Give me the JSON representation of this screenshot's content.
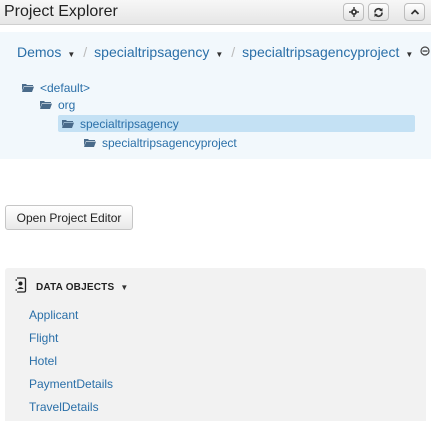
{
  "header": {
    "title": "Project Explorer",
    "buttons": [
      {
        "name": "settings",
        "icon": "gear-icon"
      },
      {
        "name": "refresh",
        "icon": "refresh-icon"
      },
      {
        "name": "collapse",
        "icon": "chevron-up-icon"
      }
    ]
  },
  "breadcrumb": {
    "items": [
      {
        "label": "Demos",
        "has_caret": true
      },
      {
        "label": "specialtripsagency",
        "has_caret": true
      },
      {
        "label": "specialtripsagencyproject",
        "has_caret": true
      }
    ],
    "collapse_icon": "minus-circle-icon"
  },
  "tree": {
    "nodes": [
      {
        "label": "<default>",
        "level": 0,
        "selected": false
      },
      {
        "label": "org",
        "level": 1,
        "selected": false
      },
      {
        "label": "specialtripsagency",
        "level": 2,
        "selected": true
      },
      {
        "label": "specialtripsagencyproject",
        "level": 3,
        "selected": false
      }
    ]
  },
  "open_project_editor": {
    "label": "Open Project Editor"
  },
  "data_objects": {
    "title": "DATA OBJECTS",
    "icon": "data-object-icon",
    "items": [
      "Applicant",
      "Flight",
      "Hotel",
      "PaymentDetails",
      "TravelDetails"
    ]
  },
  "colors": {
    "link": "#2a6fa8",
    "tree_background": "#f2f8fc",
    "selected_background": "#c4e1f4",
    "panel_background": "#f2f2f2"
  }
}
